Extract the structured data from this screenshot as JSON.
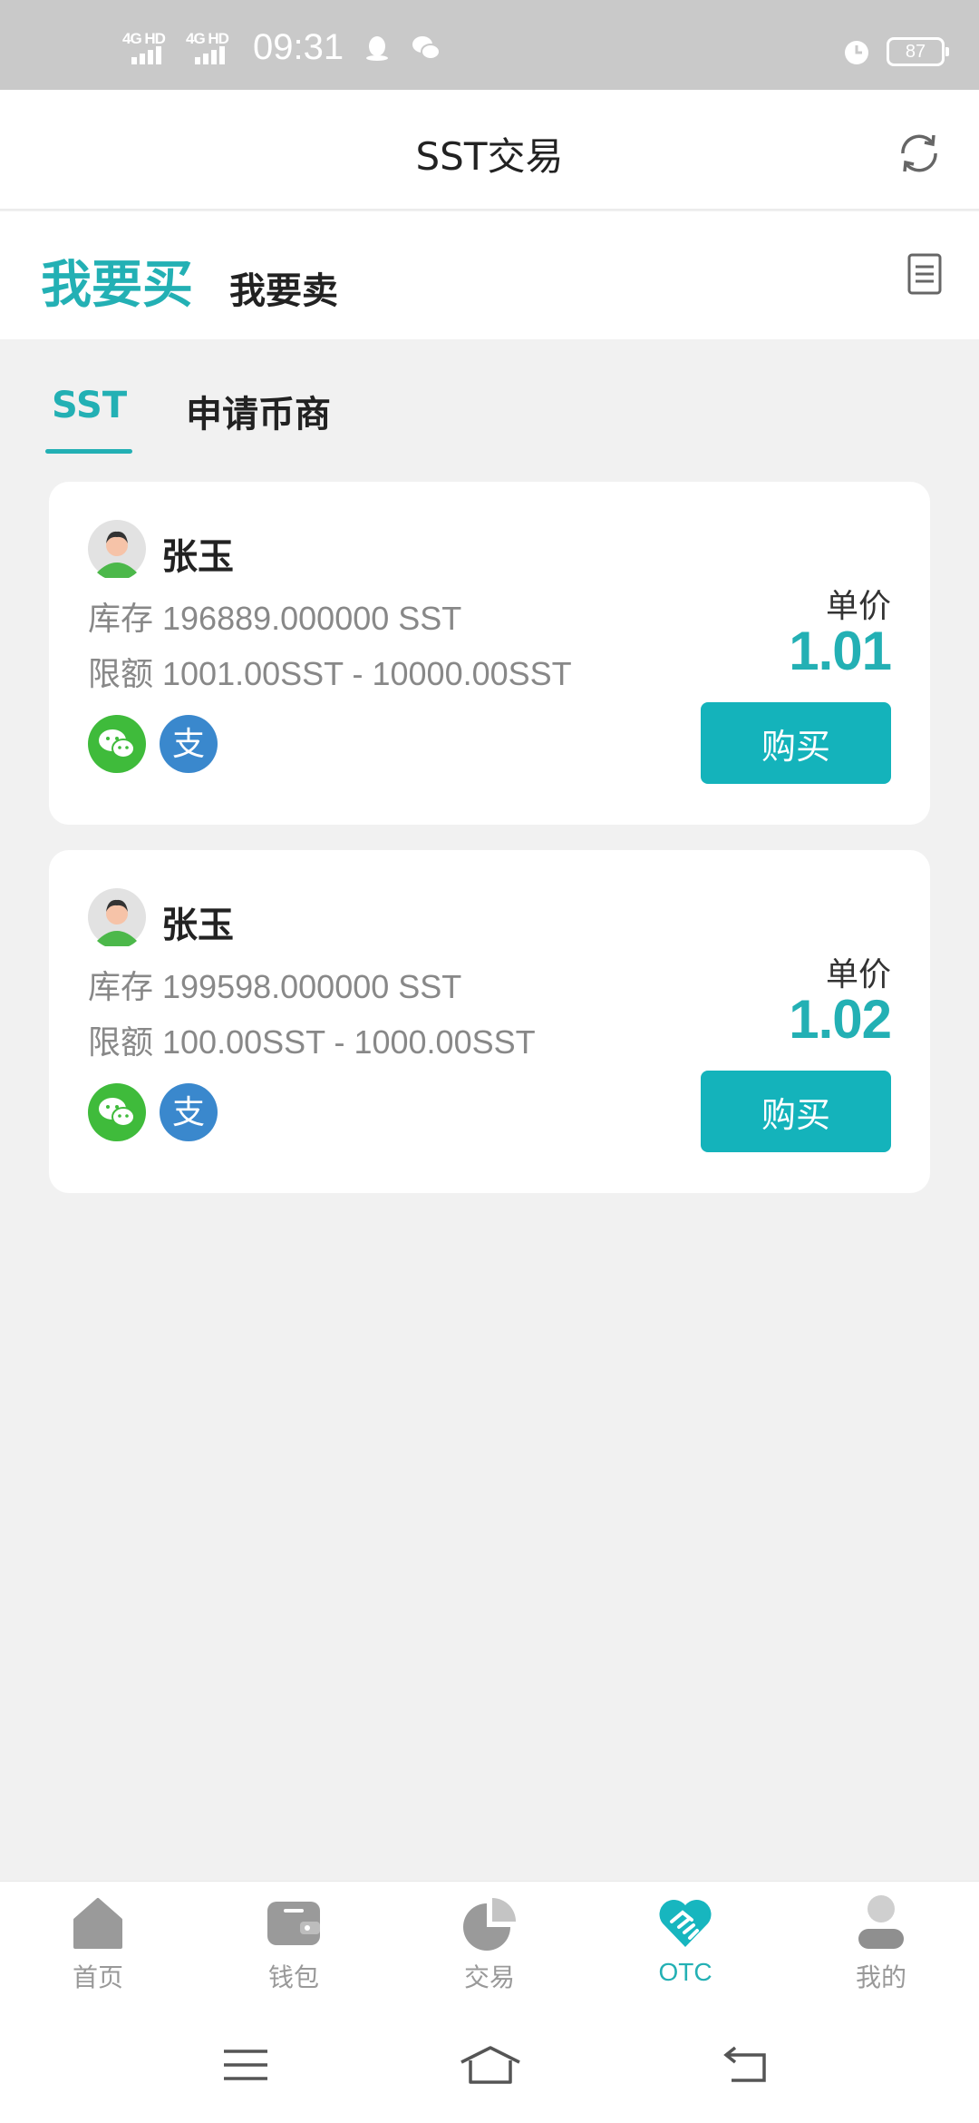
{
  "status_bar": {
    "signal1_label": "4G HD",
    "signal2_label": "4G HD",
    "time": "09:31",
    "battery": "87",
    "icons": [
      "qq-icon",
      "wechat-icon",
      "alarm-icon"
    ]
  },
  "header": {
    "title": "SST交易",
    "refresh_icon": "refresh-icon"
  },
  "trade_tabs": {
    "buy": "我要买",
    "sell": "我要卖",
    "orders_icon": "document-icon"
  },
  "coin_tabs": {
    "sst": "SST",
    "apply_merchant": "申请币商"
  },
  "listings": [
    {
      "name": "张玉",
      "stock": "库存 196889.000000 SST",
      "limit": "限额 1001.00SST - 10000.00SST",
      "price_label": "单价",
      "price": "1.01",
      "buy_label": "购买"
    },
    {
      "name": "张玉",
      "stock": "库存 199598.000000 SST",
      "limit": "限额 100.00SST - 1000.00SST",
      "price_label": "单价",
      "price": "1.02",
      "buy_label": "购买"
    }
  ],
  "bottom_nav": {
    "items": [
      {
        "label": "首页",
        "icon": "home-icon"
      },
      {
        "label": "钱包",
        "icon": "wallet-icon"
      },
      {
        "label": "交易",
        "icon": "pie-chart-icon"
      },
      {
        "label": "OTC",
        "icon": "handshake-icon"
      },
      {
        "label": "我的",
        "icon": "profile-icon"
      }
    ],
    "active": "OTC"
  },
  "colors": {
    "accent": "#23b0b4",
    "button": "#14b3bb",
    "wechat": "#3fbb3b",
    "alipay": "#3a88cd"
  }
}
